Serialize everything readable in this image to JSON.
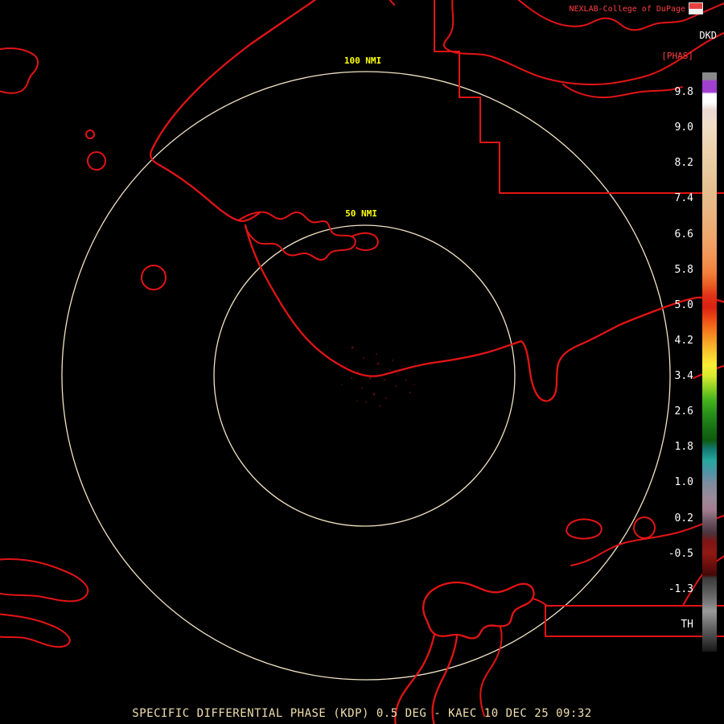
{
  "header": {
    "title": "NEXLAB-College of DuPage",
    "product_code": "DKD",
    "units": "[PHAS]"
  },
  "colorbar": {
    "tick_labels": [
      "9.8",
      "9.0",
      "8.2",
      "7.4",
      "6.6",
      "5.8",
      "5.0",
      "4.2",
      "3.4",
      "2.6",
      "1.8",
      "1.0",
      "0.2",
      "-0.5",
      "-1.3",
      "TH"
    ],
    "gradient_stops": [
      {
        "pos": 0,
        "color": "#8a8a8a"
      },
      {
        "pos": 1.2,
        "color": "#8a8a8a"
      },
      {
        "pos": 1.5,
        "color": "#a13fd1"
      },
      {
        "pos": 3.4,
        "color": "#a13fd1"
      },
      {
        "pos": 3.7,
        "color": "#ffffff"
      },
      {
        "pos": 5.2,
        "color": "#ffffff"
      },
      {
        "pos": 6.5,
        "color": "#ead9d3"
      },
      {
        "pos": 9,
        "color": "#f0dfc8"
      },
      {
        "pos": 13,
        "color": "#eed4ae"
      },
      {
        "pos": 17,
        "color": "#e9c99e"
      },
      {
        "pos": 21,
        "color": "#e6bd8d"
      },
      {
        "pos": 25,
        "color": "#ebb27e"
      },
      {
        "pos": 29,
        "color": "#f0a468"
      },
      {
        "pos": 32,
        "color": "#f29354"
      },
      {
        "pos": 34.5,
        "color": "#f0813c"
      },
      {
        "pos": 36.5,
        "color": "#ea5f24"
      },
      {
        "pos": 38.5,
        "color": "#e23317"
      },
      {
        "pos": 40.5,
        "color": "#d92112"
      },
      {
        "pos": 42.5,
        "color": "#ec4a15"
      },
      {
        "pos": 44.5,
        "color": "#f4781d"
      },
      {
        "pos": 46.5,
        "color": "#f7a226"
      },
      {
        "pos": 48.5,
        "color": "#f9cb2d"
      },
      {
        "pos": 50.5,
        "color": "#faee34"
      },
      {
        "pos": 52.5,
        "color": "#d3e92d"
      },
      {
        "pos": 54.5,
        "color": "#8cd024"
      },
      {
        "pos": 56.5,
        "color": "#46b41d"
      },
      {
        "pos": 59,
        "color": "#279019"
      },
      {
        "pos": 61.5,
        "color": "#166f13"
      },
      {
        "pos": 63.5,
        "color": "#0e5a0e"
      },
      {
        "pos": 65,
        "color": "#12776f"
      },
      {
        "pos": 67,
        "color": "#25a89f"
      },
      {
        "pos": 69,
        "color": "#4f93a8"
      },
      {
        "pos": 71,
        "color": "#7f8d9e"
      },
      {
        "pos": 73.5,
        "color": "#9b8a99"
      },
      {
        "pos": 75.5,
        "color": "#a37d90"
      },
      {
        "pos": 77.5,
        "color": "#6d5763"
      },
      {
        "pos": 79.5,
        "color": "#49353e"
      },
      {
        "pos": 81,
        "color": "#7e1414"
      },
      {
        "pos": 83,
        "color": "#901a12"
      },
      {
        "pos": 85,
        "color": "#6b0f0c"
      },
      {
        "pos": 86.8,
        "color": "#420808"
      },
      {
        "pos": 87.3,
        "color": "#3a3a3a"
      },
      {
        "pos": 89.5,
        "color": "#5a5a5a"
      },
      {
        "pos": 91.5,
        "color": "#7a7a7a"
      },
      {
        "pos": 93,
        "color": "#9a9a9a"
      },
      {
        "pos": 100,
        "color": "#161616"
      }
    ]
  },
  "range_rings": {
    "inner_label": "50 NMI",
    "outer_label": "100 NMI"
  },
  "footer": {
    "caption": "SPECIFIC DIFFERENTIAL PHASE (KDP) 0.5 DEG - KAEC 10 DEC 25 09:32"
  },
  "colors": {
    "background": "#000000",
    "map_line": "#e31414",
    "ring": "#f2e4c4",
    "ring_label": "#ffff00",
    "title": "#ff4040",
    "caption": "#f2dfae",
    "tick": "#ffffff"
  }
}
